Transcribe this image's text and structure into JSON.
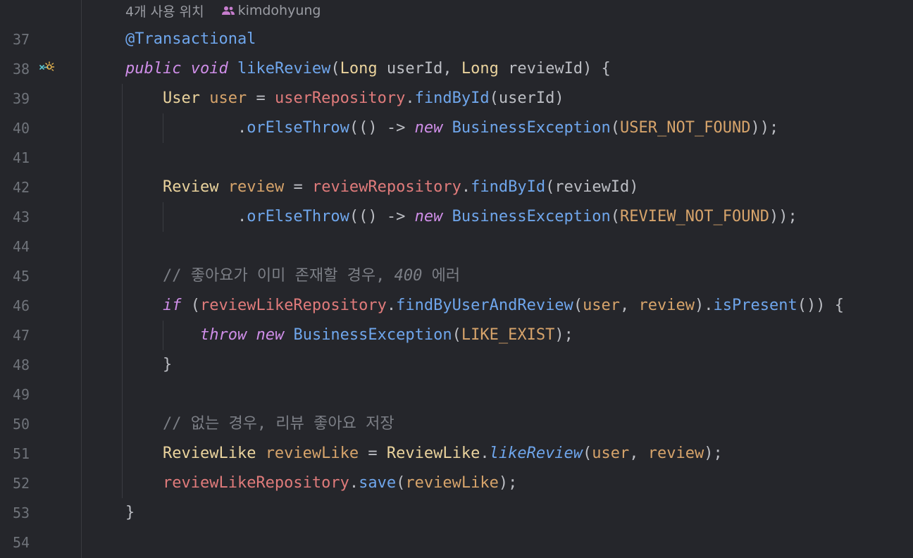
{
  "editor": {
    "usage_hint": "4개 사용 위치",
    "author": "kimdohyung",
    "gutter_icon": "implementation-marker-icon",
    "author_icon": "people-icon"
  },
  "lines": [
    {
      "n": "37",
      "tokens": [
        {
          "t": "@Transactional",
          "c": "ann"
        }
      ]
    },
    {
      "n": "38",
      "tokens": [
        {
          "t": "public",
          "c": "kw"
        },
        {
          "t": " ",
          "c": "pn"
        },
        {
          "t": "void",
          "c": "kw"
        },
        {
          "t": " ",
          "c": "pn"
        },
        {
          "t": "likeReview",
          "c": "fn"
        },
        {
          "t": "(",
          "c": "pn"
        },
        {
          "t": "Long",
          "c": "ty"
        },
        {
          "t": " userId, ",
          "c": "pn"
        },
        {
          "t": "Long",
          "c": "ty"
        },
        {
          "t": " reviewId) {",
          "c": "pn"
        }
      ]
    },
    {
      "n": "39",
      "tokens": [
        {
          "t": "    ",
          "c": "pn"
        },
        {
          "t": "User",
          "c": "ty"
        },
        {
          "t": " ",
          "c": "pn"
        },
        {
          "t": "user",
          "c": "var"
        },
        {
          "t": " = ",
          "c": "pn"
        },
        {
          "t": "userRepository",
          "c": "fld"
        },
        {
          "t": ".",
          "c": "pn"
        },
        {
          "t": "findById",
          "c": "fn"
        },
        {
          "t": "(userId)",
          "c": "pn"
        }
      ]
    },
    {
      "n": "40",
      "tokens": [
        {
          "t": "            .",
          "c": "pn"
        },
        {
          "t": "orElseThrow",
          "c": "fn"
        },
        {
          "t": "(() -> ",
          "c": "pn"
        },
        {
          "t": "new",
          "c": "kw"
        },
        {
          "t": " ",
          "c": "pn"
        },
        {
          "t": "BusinessException",
          "c": "fn"
        },
        {
          "t": "(",
          "c": "pn"
        },
        {
          "t": "USER_NOT_FOUND",
          "c": "cst"
        },
        {
          "t": "));",
          "c": "pn"
        }
      ]
    },
    {
      "n": "41",
      "tokens": []
    },
    {
      "n": "42",
      "tokens": [
        {
          "t": "    ",
          "c": "pn"
        },
        {
          "t": "Review",
          "c": "ty"
        },
        {
          "t": " ",
          "c": "pn"
        },
        {
          "t": "review",
          "c": "var"
        },
        {
          "t": " = ",
          "c": "pn"
        },
        {
          "t": "reviewRepository",
          "c": "fld"
        },
        {
          "t": ".",
          "c": "pn"
        },
        {
          "t": "findById",
          "c": "fn"
        },
        {
          "t": "(reviewId)",
          "c": "pn"
        }
      ]
    },
    {
      "n": "43",
      "tokens": [
        {
          "t": "            .",
          "c": "pn"
        },
        {
          "t": "orElseThrow",
          "c": "fn"
        },
        {
          "t": "(() -> ",
          "c": "pn"
        },
        {
          "t": "new",
          "c": "kw"
        },
        {
          "t": " ",
          "c": "pn"
        },
        {
          "t": "BusinessException",
          "c": "fn"
        },
        {
          "t": "(",
          "c": "pn"
        },
        {
          "t": "REVIEW_NOT_FOUND",
          "c": "cst"
        },
        {
          "t": "));",
          "c": "pn"
        }
      ]
    },
    {
      "n": "44",
      "tokens": []
    },
    {
      "n": "45",
      "tokens": [
        {
          "t": "    ",
          "c": "pn"
        },
        {
          "t": "// 좋아요가 이미 존재할 경우, ",
          "c": "cm"
        },
        {
          "t": "400",
          "c": "cmn"
        },
        {
          "t": " 에러",
          "c": "cm"
        }
      ]
    },
    {
      "n": "46",
      "tokens": [
        {
          "t": "    ",
          "c": "pn"
        },
        {
          "t": "if",
          "c": "kw"
        },
        {
          "t": " (",
          "c": "pn"
        },
        {
          "t": "reviewLikeRepository",
          "c": "fld"
        },
        {
          "t": ".",
          "c": "pn"
        },
        {
          "t": "findByUserAndReview",
          "c": "fn"
        },
        {
          "t": "(",
          "c": "pn"
        },
        {
          "t": "user",
          "c": "var"
        },
        {
          "t": ", ",
          "c": "pn"
        },
        {
          "t": "review",
          "c": "var"
        },
        {
          "t": ").",
          "c": "pn"
        },
        {
          "t": "isPresent",
          "c": "fn"
        },
        {
          "t": "()) {",
          "c": "pn"
        }
      ]
    },
    {
      "n": "47",
      "tokens": [
        {
          "t": "        ",
          "c": "pn"
        },
        {
          "t": "throw",
          "c": "kw"
        },
        {
          "t": " ",
          "c": "pn"
        },
        {
          "t": "new",
          "c": "kw"
        },
        {
          "t": " ",
          "c": "pn"
        },
        {
          "t": "BusinessException",
          "c": "fn"
        },
        {
          "t": "(",
          "c": "pn"
        },
        {
          "t": "LIKE_EXIST",
          "c": "cst"
        },
        {
          "t": ");",
          "c": "pn"
        }
      ]
    },
    {
      "n": "48",
      "tokens": [
        {
          "t": "    }",
          "c": "pn"
        }
      ]
    },
    {
      "n": "49",
      "tokens": []
    },
    {
      "n": "50",
      "tokens": [
        {
          "t": "    ",
          "c": "pn"
        },
        {
          "t": "// 없는 경우, 리뷰 좋아요 저장",
          "c": "cm"
        }
      ]
    },
    {
      "n": "51",
      "tokens": [
        {
          "t": "    ",
          "c": "pn"
        },
        {
          "t": "ReviewLike",
          "c": "ty"
        },
        {
          "t": " ",
          "c": "pn"
        },
        {
          "t": "reviewLike",
          "c": "var"
        },
        {
          "t": " = ",
          "c": "pn"
        },
        {
          "t": "ReviewLike",
          "c": "ty"
        },
        {
          "t": ".",
          "c": "pn"
        },
        {
          "t": "likeReview",
          "c": "fni"
        },
        {
          "t": "(",
          "c": "pn"
        },
        {
          "t": "user",
          "c": "var"
        },
        {
          "t": ", ",
          "c": "pn"
        },
        {
          "t": "review",
          "c": "var"
        },
        {
          "t": ");",
          "c": "pn"
        }
      ]
    },
    {
      "n": "52",
      "tokens": [
        {
          "t": "    ",
          "c": "pn"
        },
        {
          "t": "reviewLikeRepository",
          "c": "fld"
        },
        {
          "t": ".",
          "c": "pn"
        },
        {
          "t": "save",
          "c": "fn"
        },
        {
          "t": "(",
          "c": "pn"
        },
        {
          "t": "reviewLike",
          "c": "var"
        },
        {
          "t": ");",
          "c": "pn"
        }
      ]
    },
    {
      "n": "53",
      "tokens": [
        {
          "t": "}",
          "c": "pn"
        }
      ]
    },
    {
      "n": "54",
      "tokens": []
    }
  ],
  "colors": {
    "background": "#25262b",
    "keyword": "#cf8ee8",
    "type": "#ead39d",
    "field": "#e07b7b",
    "variable": "#d7a46b",
    "method": "#6fa6ec",
    "comment": "#7c7f86",
    "line_number": "#6f737a"
  }
}
